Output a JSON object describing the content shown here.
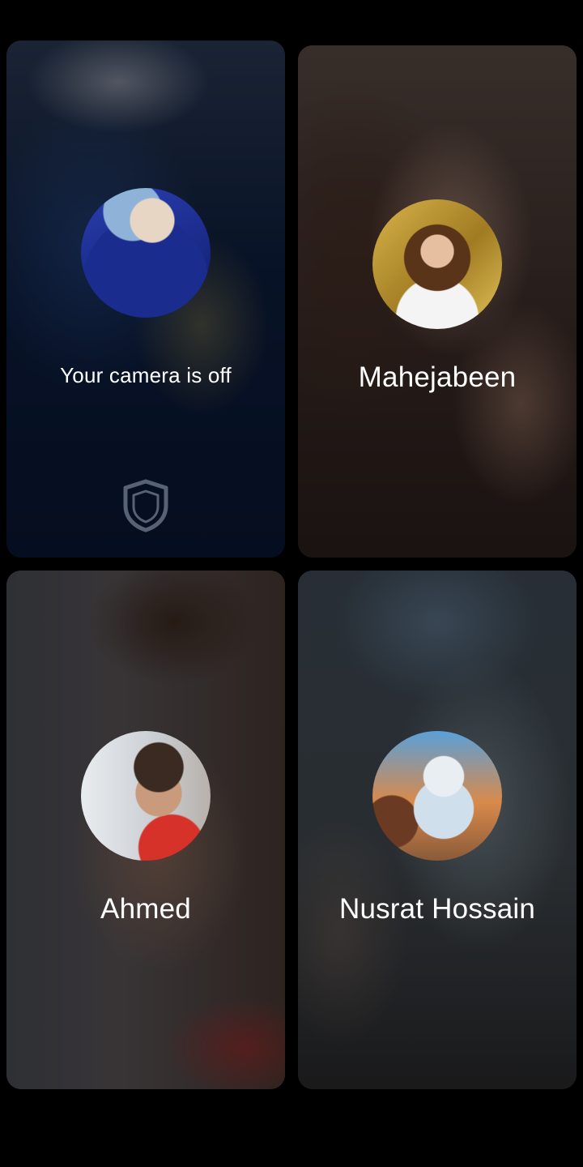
{
  "participants": [
    {
      "name": "Your camera is off",
      "is_self": true,
      "avatar_icon": "user-avatar"
    },
    {
      "name": "Mahejabeen",
      "is_self": false,
      "avatar_icon": "user-avatar"
    },
    {
      "name": "Ahmed",
      "is_self": false,
      "avatar_icon": "user-avatar"
    },
    {
      "name": "Nusrat Hossain",
      "is_self": false,
      "avatar_icon": "user-avatar"
    }
  ],
  "icons": {
    "self_tile_watermark": "shield-icon"
  },
  "colors": {
    "background": "#000000",
    "name_text": "#ffffff"
  }
}
